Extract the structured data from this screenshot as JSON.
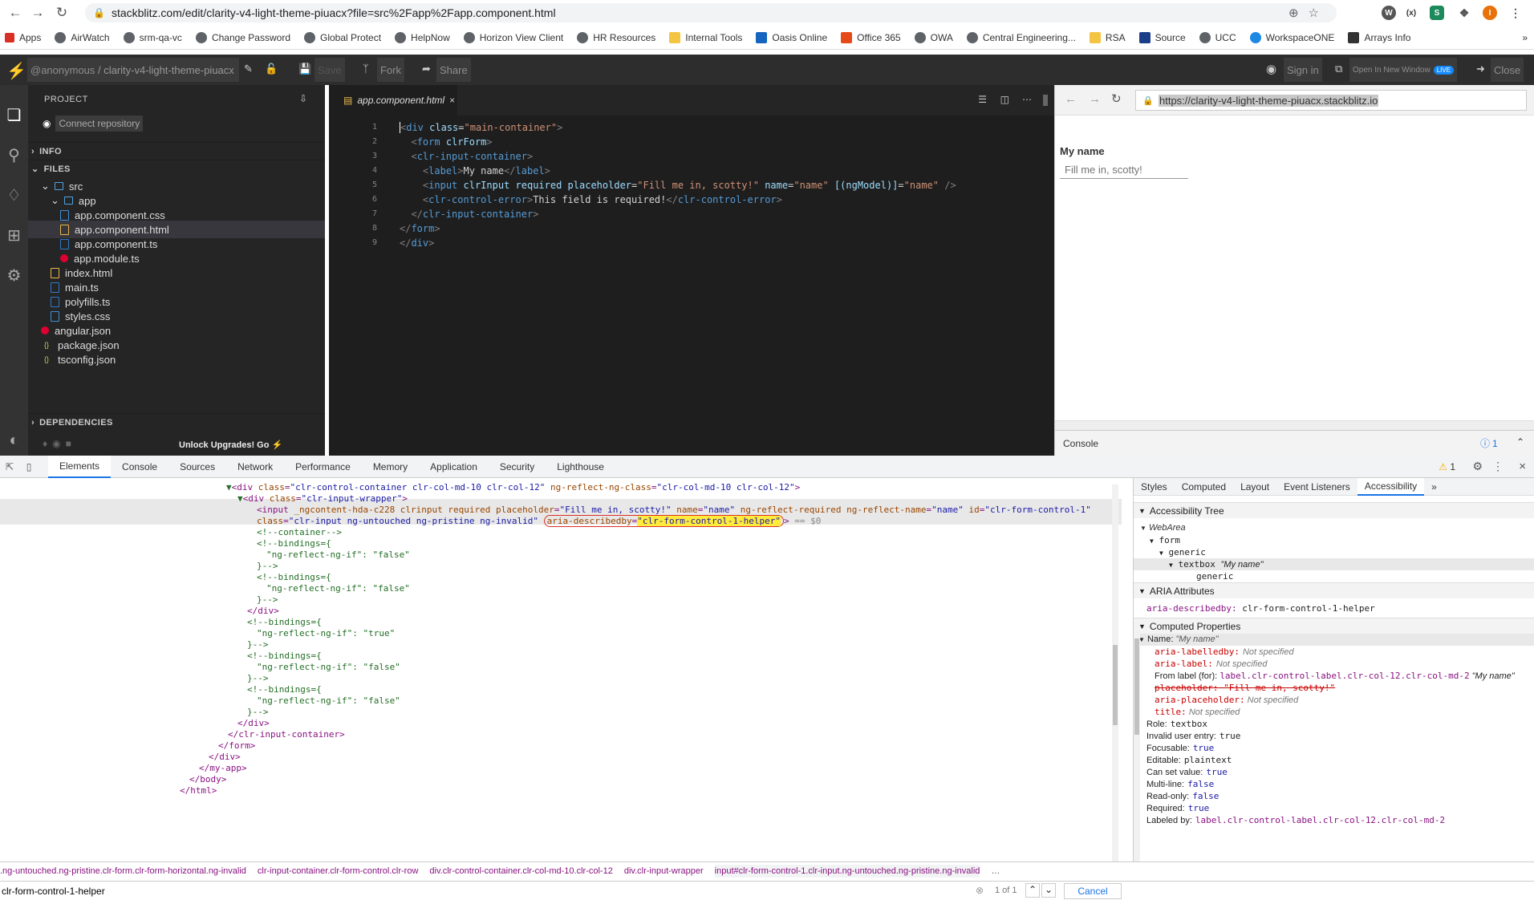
{
  "browser": {
    "url": "stackblitz.com/edit/clarity-v4-light-theme-piuacx?file=src%2Fapp%2Fapp.component.html",
    "bookmarks": [
      "Apps",
      "AirWatch",
      "srm-qa-vc",
      "Change Password",
      "Global Protect",
      "HelpNow",
      "Horizon View Client",
      "HR Resources",
      "Internal Tools",
      "Oasis Online",
      "Office 365",
      "OWA",
      "Central Engineering...",
      "RSA",
      "Source",
      "UCC",
      "WorkspaceONE",
      "Arrays Info"
    ],
    "more_bookmarks": "»",
    "profile_initial": "I"
  },
  "stackblitz": {
    "user": "@anonymous",
    "project_name": "/ clarity-v4-light-theme-piuacx",
    "save": "Save",
    "fork": "Fork",
    "share": "Share",
    "sign_in": "Sign in",
    "open_new_window": "Open In New Window",
    "live": "LIVE",
    "close": "Close"
  },
  "project": {
    "title": "PROJECT",
    "connect_repo": "Connect repository",
    "sections": {
      "info": "INFO",
      "files": "FILES",
      "dependencies": "DEPENDENCIES"
    },
    "tree": [
      {
        "label": "src",
        "type": "folder",
        "indent": 1
      },
      {
        "label": "app",
        "type": "folder",
        "indent": 2
      },
      {
        "label": "app.component.css",
        "type": "css",
        "indent": 3
      },
      {
        "label": "app.component.html",
        "type": "html",
        "indent": 3
      },
      {
        "label": "app.component.ts",
        "type": "ts",
        "indent": 3
      },
      {
        "label": "app.module.ts",
        "type": "ng",
        "indent": 3
      },
      {
        "label": "index.html",
        "type": "html",
        "indent": 2
      },
      {
        "label": "main.ts",
        "type": "ts",
        "indent": 2
      },
      {
        "label": "polyfills.ts",
        "type": "ts",
        "indent": 2
      },
      {
        "label": "styles.css",
        "type": "css",
        "indent": 2
      },
      {
        "label": "angular.json",
        "type": "ng",
        "indent": 1
      },
      {
        "label": "package.json",
        "type": "json",
        "indent": 1
      },
      {
        "label": "tsconfig.json",
        "type": "json",
        "indent": 1
      }
    ],
    "unlock": "Unlock Upgrades! Go"
  },
  "editor": {
    "tab": "app.component.html",
    "lines": [
      "1",
      "2",
      "3",
      "4",
      "5",
      "6",
      "7",
      "8",
      "9"
    ]
  },
  "preview": {
    "url": "https://clarity-v4-light-theme-piuacx.stackblitz.io",
    "label": "My name",
    "placeholder": "Fill me in, scotty!",
    "console": "Console",
    "console_count": "1"
  },
  "devtools": {
    "tabs": [
      "Elements",
      "Console",
      "Sources",
      "Network",
      "Performance",
      "Memory",
      "Application",
      "Security",
      "Lighthouse"
    ],
    "warnings": "1",
    "side_tabs": [
      "Styles",
      "Computed",
      "Layout",
      "Event Listeners",
      "Accessibility"
    ],
    "acc_tree_title": "Accessibility Tree",
    "acc_tree": [
      "WebArea",
      "form",
      "generic",
      "textbox",
      "\"My name\"",
      "generic"
    ],
    "aria_title": "ARIA Attributes",
    "aria_attr_name": "aria-describedby:",
    "aria_attr_value": "clr-form-control-1-helper",
    "computed_title": "Computed Properties",
    "name_label": "Name:",
    "name_value": "\"My name\"",
    "props": [
      {
        "k": "aria-labelledby:",
        "v": "Not specified"
      },
      {
        "k": "aria-label:",
        "v": "Not specified"
      }
    ],
    "from_label": "From label (for):",
    "from_label_value": "label.clr-control-label.clr-col-12.clr-col-md-2",
    "placeholder_strike": "placeholder: \"Fill me in, scotty!\"",
    "aria_placeholder": "aria-placeholder:",
    "title_prop": "title:",
    "not_specified": "Not specified",
    "computed": [
      {
        "k": "Role:",
        "v": "textbox"
      },
      {
        "k": "Invalid user entry:",
        "v": "true"
      },
      {
        "k": "Focusable:",
        "v": "true"
      },
      {
        "k": "Editable:",
        "v": "plaintext"
      },
      {
        "k": "Can set value:",
        "v": "true"
      },
      {
        "k": "Multi-line:",
        "v": "false"
      },
      {
        "k": "Read-only:",
        "v": "false"
      },
      {
        "k": "Required:",
        "v": "true"
      },
      {
        "k": "Labeled by:",
        "v": "label.clr-control-label.clr-col-12.clr-col-md-2"
      }
    ],
    "dollar0": "== $0",
    "breadcrumbs": [
      ".ng-untouched.ng-pristine.clr-form.clr-form-horizontal.ng-invalid",
      "clr-input-container.clr-form-control.clr-row",
      "div.clr-control-container.clr-col-md-10.clr-col-12",
      "div.clr-input-wrapper",
      "input#clr-form-control-1.clr-input.ng-untouched.ng-pristine.ng-invalid",
      "…"
    ],
    "search_value": "clr-form-control-1-helper",
    "search_count": "1 of 1",
    "cancel": "Cancel"
  }
}
